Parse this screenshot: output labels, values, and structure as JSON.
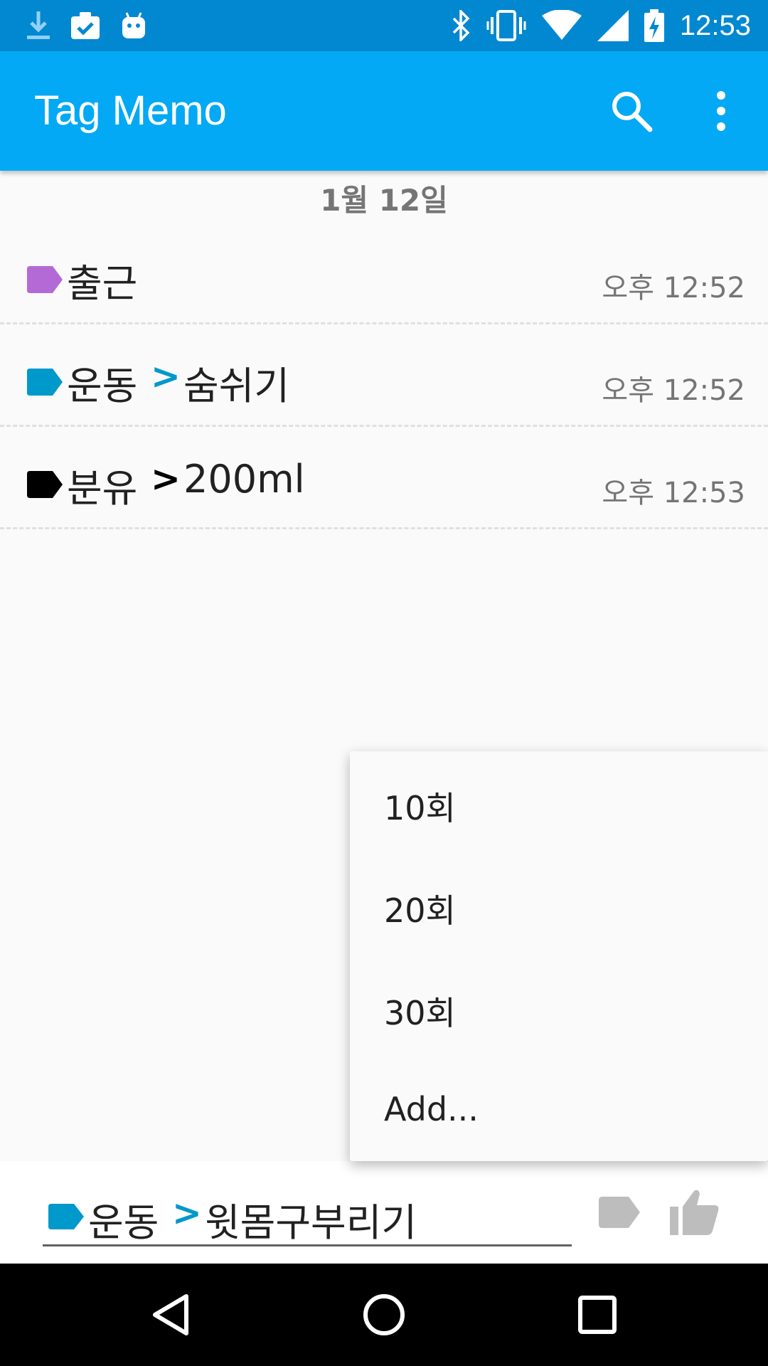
{
  "status_bar": {
    "time": "12:53"
  },
  "app_bar": {
    "title": "Tag Memo",
    "search_icon": "search-icon",
    "more_icon": "more-vert-icon"
  },
  "list": {
    "date_header": "1월 12일",
    "items": [
      {
        "tag": "출근",
        "sub": "",
        "time": "오후 12:52",
        "color": "#b36ad6"
      },
      {
        "tag": "운동",
        "sub": "숨쉬기",
        "time": "오후 12:52",
        "color": "#0099cc"
      },
      {
        "tag": "분유",
        "sub": "200ml",
        "time": "오후 12:53",
        "color": "#000000"
      }
    ]
  },
  "popup": {
    "items": [
      "10회",
      "20회",
      "30회",
      "Add..."
    ]
  },
  "input": {
    "tag": "운동",
    "separator": ">",
    "sub": "윗몸구부리기",
    "tag_color": "#0099cc",
    "tag_button_icon": "label-icon",
    "submit_icon": "thumb-up-icon"
  },
  "nav": {
    "back_icon": "back-icon",
    "home_icon": "home-icon",
    "recents_icon": "recents-icon"
  },
  "colors": {
    "status_bar": "#0288d1",
    "app_bar": "#03a9f4",
    "accent": "#0099cc"
  }
}
